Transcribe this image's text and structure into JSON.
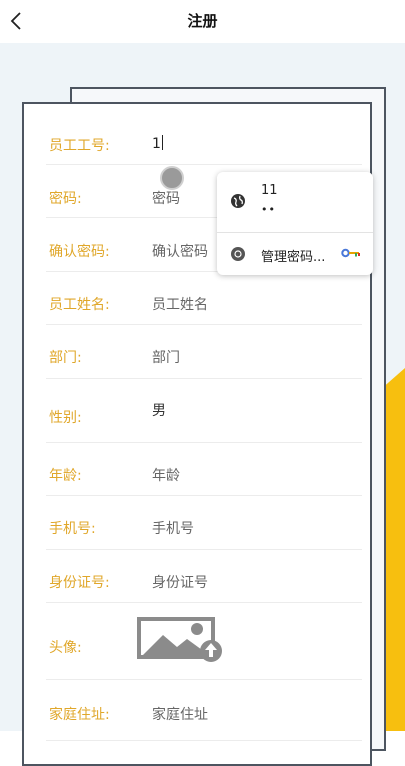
{
  "header": {
    "title": "注册"
  },
  "form": {
    "employee_id": {
      "label": "员工工号:",
      "value": "1"
    },
    "password": {
      "label": "密码:",
      "placeholder": "密码"
    },
    "confirm_password": {
      "label": "确认密码:",
      "placeholder": "确认密码"
    },
    "name": {
      "label": "员工姓名:",
      "placeholder": "员工姓名"
    },
    "department": {
      "label": "部门:",
      "placeholder": "部门"
    },
    "gender": {
      "label": "性别:",
      "value": "男"
    },
    "age": {
      "label": "年龄:",
      "placeholder": "年龄"
    },
    "phone": {
      "label": "手机号:",
      "placeholder": "手机号"
    },
    "id_card": {
      "label": "身份证号:",
      "placeholder": "身份证号"
    },
    "avatar": {
      "label": "头像:"
    },
    "address": {
      "label": "家庭住址:",
      "placeholder": "家庭住址"
    }
  },
  "autofill_popup": {
    "suggestion_username": "11",
    "suggestion_password_mask": "••",
    "manage_passwords_label": "管理密码..."
  },
  "colors": {
    "label": "#e0a72a",
    "accent_yellow": "#f7bf0f",
    "card_border": "#4d5560"
  }
}
